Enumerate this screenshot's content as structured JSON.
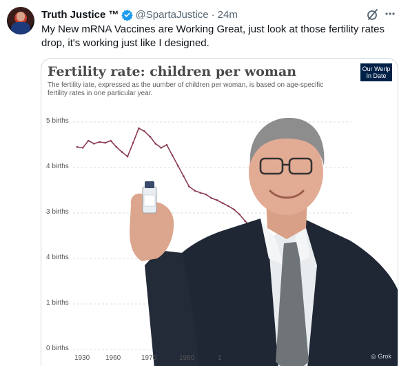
{
  "author": {
    "name": "Truth Justice ™",
    "handle": "@SpartaJustice",
    "separator": "·",
    "time": "24m"
  },
  "tweet": {
    "text": "My New mRNA Vaccines are Working Great, just look at those fertility rates drop, it's working just like I designed."
  },
  "media": {
    "title": "Fertility rate: children per woman",
    "subtitle": "The fertility iate, expressed as the uumber of children per woman, is based on age-specific fertility rates in one particular year.",
    "logo": "Our Werlp In Date",
    "watermark": "Grok",
    "chart_data": {
      "type": "line",
      "title": "Fertility rate: children per woman",
      "y_tick_labels": [
        "5 births",
        "4 births",
        "3 births",
        "4 births",
        "1 births",
        "0 births"
      ],
      "x_tick_labels": [
        "1930",
        "1960",
        "1970",
        "1980",
        "1"
      ],
      "ylim": [
        0,
        5.5
      ],
      "x": [
        1950,
        1951,
        1952,
        1953,
        1954,
        1955,
        1956,
        1957,
        1958,
        1959,
        1960,
        1961,
        1962,
        1963,
        1964,
        1965,
        1966,
        1967,
        1968,
        1969,
        1970,
        1971,
        1972,
        1973,
        1974,
        1975,
        1976,
        1977,
        1978,
        1979,
        1980,
        1981,
        1982,
        1983
      ],
      "series": [
        {
          "values": [
            4.9,
            4.88,
            5.05,
            4.98,
            5.02,
            5.0,
            5.05,
            4.9,
            4.78,
            4.67,
            5.0,
            5.35,
            5.28,
            5.15,
            4.98,
            4.88,
            4.95,
            4.7,
            4.45,
            4.2,
            3.95,
            3.85,
            3.8,
            3.76,
            3.67,
            3.62,
            3.55,
            3.48,
            3.4,
            3.28,
            3.12,
            3.0,
            2.92,
            2.86
          ]
        }
      ],
      "grid": true
    }
  },
  "icons": {
    "verified": "verified-badge-icon",
    "grok": "grok-icon",
    "more": "more-icon"
  },
  "colors": {
    "line": "#8b3a4f",
    "verified": "#1d9bf0",
    "suit": "#1f2634",
    "tie": "#6f7478"
  }
}
